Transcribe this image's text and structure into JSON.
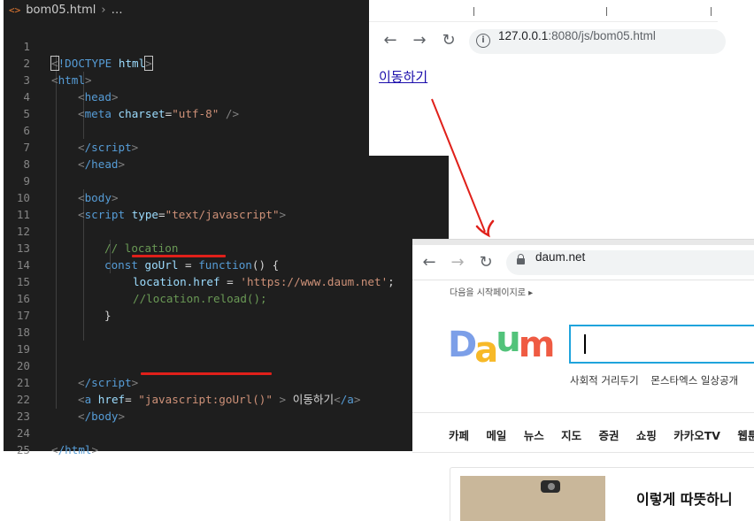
{
  "editor": {
    "breadcrumb_file": "bom05.html",
    "breadcrumb_rest": "…",
    "lines": [
      {
        "n": "1"
      },
      {
        "n": "2"
      },
      {
        "n": "3"
      },
      {
        "n": "4"
      },
      {
        "n": "5"
      },
      {
        "n": "6"
      },
      {
        "n": "7"
      },
      {
        "n": "8"
      },
      {
        "n": "9"
      },
      {
        "n": "10"
      },
      {
        "n": "11"
      },
      {
        "n": "12"
      },
      {
        "n": "13"
      },
      {
        "n": "14"
      },
      {
        "n": "15"
      },
      {
        "n": "16"
      },
      {
        "n": "17"
      },
      {
        "n": "18"
      },
      {
        "n": "19"
      },
      {
        "n": "20"
      },
      {
        "n": "21"
      },
      {
        "n": "22"
      },
      {
        "n": "23"
      },
      {
        "n": "24"
      },
      {
        "n": "25"
      }
    ],
    "code": {
      "doctype_open": "<",
      "doctype": "!DOCTYPE",
      "doctype_html": "html",
      "doctype_close": ">",
      "html_tag": "html",
      "head_tag": "head",
      "meta_tag": "meta",
      "charset_attr": "charset",
      "charset_val": "\"utf-8\"",
      "script_close": "/script",
      "head_close": "/head",
      "body_tag": "body",
      "script_tag": "script",
      "type_attr": "type",
      "type_val": "\"text/javascript\"",
      "comment_location": "// location",
      "const_kw": "const",
      "gourl": "goUrl",
      "function_kw": "function",
      "location_href": "location.href",
      "daum_url": "'https://www.daum.net'",
      "comment_reload": "//location.reload();",
      "a_tag": "a",
      "href_attr": "href",
      "href_val": "\"javascript:goUrl()\"",
      "link_text": "이동하기",
      "a_close": "/a",
      "body_close": "/body",
      "html_close": "/html"
    }
  },
  "browser1": {
    "url_host": "127.0.0.1",
    "url_path": ":8080/js/bom05.html",
    "link_label": "이동하기"
  },
  "browser2": {
    "url": "daum.net",
    "startpage": "다음을 시작페이지로 ▸",
    "logo_letters": [
      "D",
      "a",
      "u",
      "m"
    ],
    "logo_colors": [
      "#7c9fe8",
      "#f7b928",
      "#52c37a",
      "#ef5b43"
    ],
    "under_search": [
      "사회적 거리두기",
      "몬스타엑스 일상공개"
    ],
    "nav": [
      "카페",
      "메일",
      "뉴스",
      "지도",
      "증권",
      "쇼핑",
      "카카오TV",
      "웹툰"
    ],
    "headline": "이렇게 따뜻하니"
  },
  "colors": {
    "editor_bg": "#1e1e1e",
    "annotation_red": "#e0201a",
    "search_border": "#1fa4dc",
    "link_color": "#1a0dab"
  }
}
